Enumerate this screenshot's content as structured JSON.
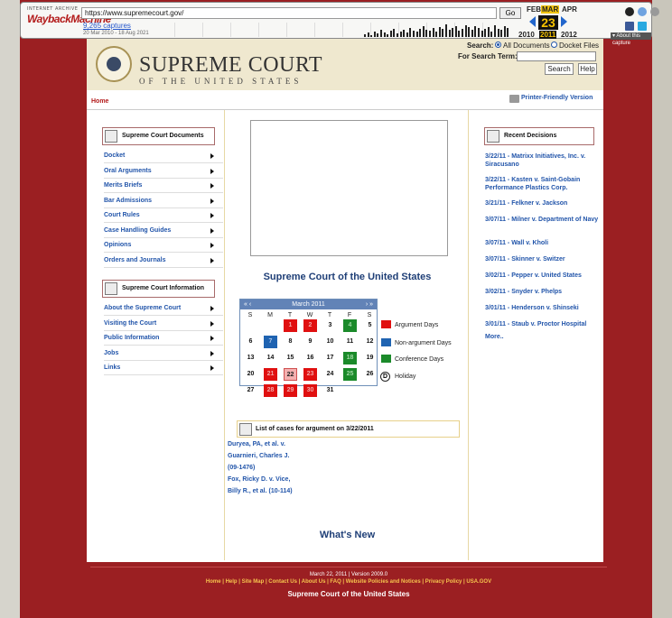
{
  "wayback": {
    "logo_small": "INTERNET ARCHIVE",
    "logo_big": "WaybackMachine",
    "url": "https://www.supremecourt.gov/",
    "go_label": "Go",
    "captures": "9,265 captures",
    "date_range": "20 Mar 2010 - 18 Aug 2021",
    "months": [
      "FEB",
      "MAR",
      "APR"
    ],
    "day": "23",
    "years": [
      "2010",
      "2011",
      "2012"
    ],
    "about": "▾ About this capture"
  },
  "header": {
    "title": "SUPREME COURT",
    "subtitle": "OF THE UNITED STATES",
    "search_label": "Search:",
    "opt_all": "All Documents",
    "opt_docket": "Docket Files",
    "term_label": "For Search Term:",
    "search_btn": "Search",
    "help_btn": "Help"
  },
  "breadcrumb": {
    "home": "Home",
    "printer": "Printer-Friendly Version"
  },
  "left": {
    "docs_title": "Supreme Court Documents",
    "docs": [
      "Docket",
      "Oral Arguments",
      "Merits Briefs",
      "Bar Admissions",
      "Court Rules",
      "Case Handling Guides",
      "Opinions",
      "Orders and Journals"
    ],
    "info_title": "Supreme Court Information",
    "info": [
      "About the Supreme Court",
      "Visiting the Court",
      "Public Information",
      "Jobs",
      "Links"
    ]
  },
  "main": {
    "title": "Supreme Court of the United States",
    "calendar": {
      "month": "March 2011",
      "nav_prev": "« ‹",
      "nav_next": "› »",
      "dow": [
        "S",
        "M",
        "T",
        "W",
        "T",
        "F",
        "S"
      ],
      "days": [
        {
          "d": "1",
          "t": "red"
        },
        {
          "d": "2",
          "t": "red"
        },
        {
          "d": "3",
          "t": ""
        },
        {
          "d": "4",
          "t": "green"
        },
        {
          "d": "5",
          "t": ""
        },
        {
          "d": "6",
          "t": ""
        },
        {
          "d": "7",
          "t": "blue"
        },
        {
          "d": "8",
          "t": ""
        },
        {
          "d": "9",
          "t": ""
        },
        {
          "d": "10",
          "t": ""
        },
        {
          "d": "11",
          "t": ""
        },
        {
          "d": "12",
          "t": ""
        },
        {
          "d": "13",
          "t": ""
        },
        {
          "d": "14",
          "t": ""
        },
        {
          "d": "15",
          "t": ""
        },
        {
          "d": "16",
          "t": ""
        },
        {
          "d": "17",
          "t": ""
        },
        {
          "d": "18",
          "t": "green"
        },
        {
          "d": "19",
          "t": ""
        },
        {
          "d": "20",
          "t": ""
        },
        {
          "d": "21",
          "t": "red"
        },
        {
          "d": "22",
          "t": "today"
        },
        {
          "d": "23",
          "t": "red"
        },
        {
          "d": "24",
          "t": ""
        },
        {
          "d": "25",
          "t": "green"
        },
        {
          "d": "26",
          "t": ""
        },
        {
          "d": "27",
          "t": ""
        },
        {
          "d": "28",
          "t": "red"
        },
        {
          "d": "29",
          "t": "red"
        },
        {
          "d": "30",
          "t": "red"
        },
        {
          "d": "31",
          "t": ""
        }
      ]
    },
    "legend": {
      "argument": "Argument Days",
      "non_argument": "Non-argument Days",
      "conference": "Conference Days",
      "holiday": "Holiday",
      "holiday_glyph": "D"
    },
    "colors": {
      "argument": "#e01010",
      "non_argument": "#1f63b1",
      "conference": "#1b8a2a"
    },
    "cases_title": "List of cases for argument on 3/22/2011",
    "cases": [
      "Duryea, PA, et al. v.",
      "Guarnieri, Charles J.",
      "(09-1476)",
      "Fox, Ricky D. v. Vice,",
      "Billy R., et al. (10-114)"
    ],
    "whats_new": "What's New"
  },
  "right": {
    "title": "Recent Decisions",
    "decisions": [
      "3/22/11 - Matrixx Initiatives, Inc. v. Siracusano",
      "3/22/11 - Kasten v. Saint-Gobain Performance Plastics Corp.",
      "3/21/11 - Felkner v. Jackson",
      "3/07/11 - Milner v. Department of Navy",
      "3/07/11 - Wall v. Kholi",
      "3/07/11 - Skinner v. Switzer",
      "3/02/11 - Pepper v. United States",
      "3/02/11 - Snyder v. Phelps",
      "3/01/11 - Henderson v. Shinseki",
      "3/01/11 - Staub v. Proctor Hospital"
    ],
    "more": "More.."
  },
  "footer": {
    "version": "March 22, 2011 | Version 2009.0",
    "links": "Home | Help | Site Map | Contact Us | About Us | FAQ | Website Policies and Notices | Privacy Policy | USA.GOV",
    "org": "Supreme Court of the United States"
  }
}
